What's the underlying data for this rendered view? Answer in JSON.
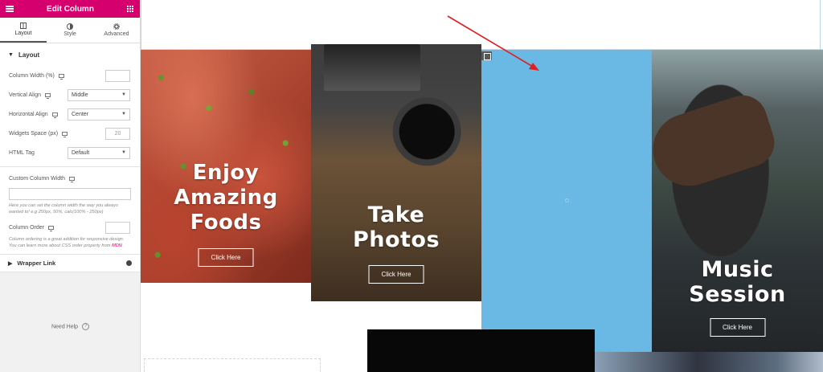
{
  "panel": {
    "title": "Edit Column",
    "tabs": [
      {
        "label": "Layout",
        "icon": "columns-icon",
        "active": true
      },
      {
        "label": "Style",
        "icon": "half-circle-icon",
        "active": false
      },
      {
        "label": "Advanced",
        "icon": "gear-icon",
        "active": false
      }
    ],
    "layout_section": {
      "title": "Layout",
      "column_width": {
        "label": "Column Width (%)",
        "value": ""
      },
      "vertical_align": {
        "label": "Vertical Align",
        "value": "Middle"
      },
      "horizontal_align": {
        "label": "Horizontal Align",
        "value": "Center"
      },
      "widgets_space": {
        "label": "Widgets Space (px)",
        "value": "",
        "placeholder": "20"
      },
      "html_tag": {
        "label": "HTML Tag",
        "value": "Default"
      },
      "custom_column_width": {
        "label": "Custom Column Width",
        "value": "",
        "help": "Here you can set the column width the way you always wanted to! e.g 250px, 50%, calc(100% - 250px)"
      },
      "column_order": {
        "label": "Column Order",
        "value": "",
        "help_prefix": "Column ordering is a great addition for responsive design. You can learn more about CSS order property from ",
        "help_link": "MDN"
      }
    },
    "wrapper_link": {
      "title": "Wrapper Link"
    },
    "need_help": "Need Help",
    "accent_color": "#d5006d"
  },
  "canvas": {
    "cards": [
      {
        "title_line1": "Enjoy",
        "title_line2": "Amazing",
        "title_line3": "Foods",
        "button": "Click Here"
      },
      {
        "title_line1": "Take",
        "title_line2": "Photos",
        "button": "Click Here"
      },
      {
        "title_line1": "Music",
        "title_line2": "Session",
        "button": "Click Here"
      }
    ],
    "selected_column_color": "#6ab9e4",
    "arrow_color": "#e02020"
  }
}
